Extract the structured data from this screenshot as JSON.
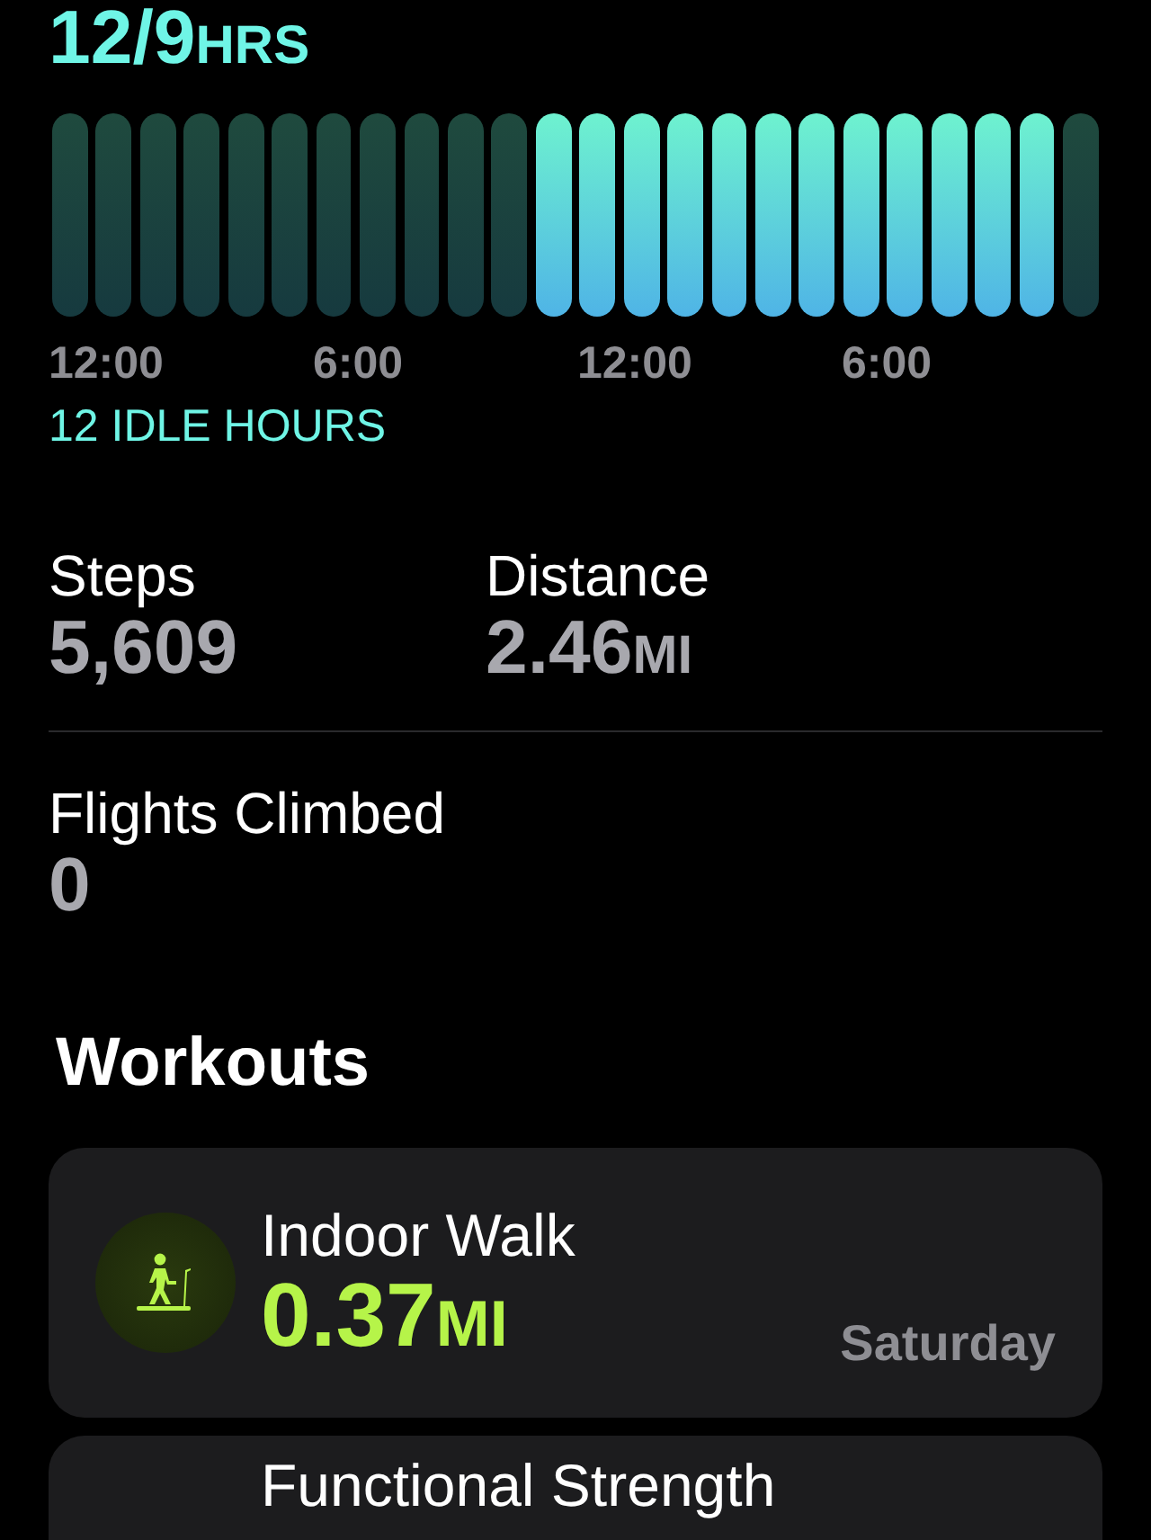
{
  "stand": {
    "value": "12/9",
    "unit": "HRS",
    "hours": [
      {
        "active": false
      },
      {
        "active": false
      },
      {
        "active": false
      },
      {
        "active": false
      },
      {
        "active": false
      },
      {
        "active": false
      },
      {
        "active": false
      },
      {
        "active": false
      },
      {
        "active": false
      },
      {
        "active": false
      },
      {
        "active": false
      },
      {
        "active": true
      },
      {
        "active": true
      },
      {
        "active": true
      },
      {
        "active": true
      },
      {
        "active": true
      },
      {
        "active": true
      },
      {
        "active": true
      },
      {
        "active": true
      },
      {
        "active": true
      },
      {
        "active": true
      },
      {
        "active": true
      },
      {
        "active": true
      },
      {
        "active": false
      }
    ],
    "time_labels": [
      "12:00",
      "6:00",
      "12:00",
      "6:00"
    ],
    "idle": "12 IDLE HOURS"
  },
  "stats": [
    {
      "label": "Steps",
      "value": "5,609"
    },
    {
      "label": "Distance",
      "value": "2.46",
      "unit": "MI"
    }
  ],
  "flights": {
    "label": "Flights Climbed",
    "value": "0"
  },
  "workouts": {
    "title": "Workouts",
    "items": [
      {
        "name": "Indoor Walk",
        "value": "0.37",
        "unit": "MI",
        "day": "Saturday"
      },
      {
        "name": "Functional Strength"
      }
    ]
  }
}
